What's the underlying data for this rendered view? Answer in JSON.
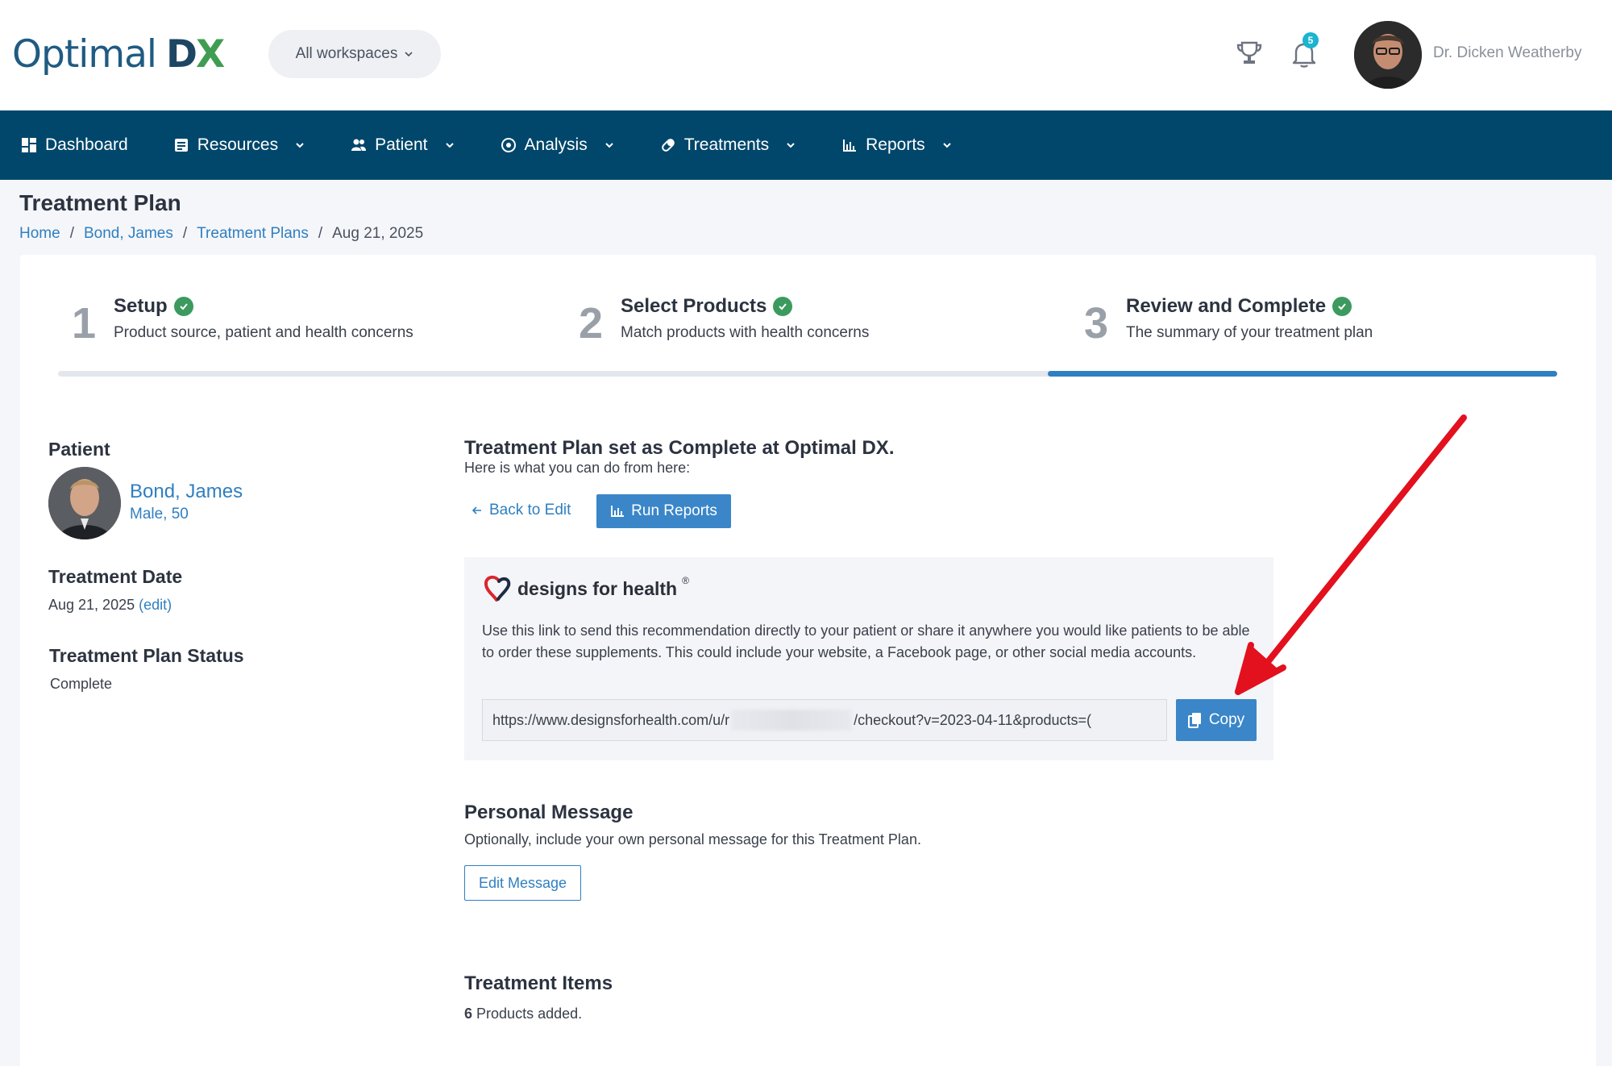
{
  "header": {
    "logo_part1": "Optimal",
    "logo_part2": "D",
    "logo_part3": "X",
    "workspace_select": "All workspaces",
    "notification_count": "5",
    "user_name": "Dr. Dicken Weatherby"
  },
  "nav": {
    "items": [
      {
        "label": "Dashboard",
        "icon": "dashboard-icon"
      },
      {
        "label": "Resources",
        "icon": "document-icon"
      },
      {
        "label": "Patient",
        "icon": "users-icon"
      },
      {
        "label": "Analysis",
        "icon": "target-icon"
      },
      {
        "label": "Treatments",
        "icon": "pill-icon"
      },
      {
        "label": "Reports",
        "icon": "bar-chart-icon"
      }
    ]
  },
  "page": {
    "title": "Treatment Plan",
    "breadcrumb": [
      "Home",
      "Bond, James",
      "Treatment Plans",
      "Aug 21, 2025"
    ]
  },
  "steps": [
    {
      "number": "1",
      "title": "Setup",
      "subtitle": "Product source, patient and health concerns"
    },
    {
      "number": "2",
      "title": "Select Products",
      "subtitle": "Match products with health concerns"
    },
    {
      "number": "3",
      "title": "Review and Complete",
      "subtitle": "The summary of your treatment plan"
    }
  ],
  "progress": {
    "active_step": 3,
    "total_steps": 3
  },
  "patient": {
    "label": "Patient",
    "name": "Bond, James",
    "meta": "Male, 50",
    "treatment_date_label": "Treatment Date",
    "treatment_date": "Aug 21, 2025",
    "edit_label": "(edit)",
    "status_label": "Treatment Plan Status",
    "status": "Complete"
  },
  "complete": {
    "title": "Treatment Plan set as Complete at Optimal DX.",
    "subtitle": "Here is what you can do from here:",
    "back_label": "Back to Edit",
    "run_reports_label": "Run Reports"
  },
  "dfh": {
    "brand": "designs for health",
    "brand_mark": "®",
    "description": "Use this link to send this recommendation directly to your patient or share it anywhere you would like patients to be able to order these supplements. This could include your website, a Facebook page, or other social media accounts.",
    "url_start": "https://www.designsforhealth.com/u/r",
    "url_end": "/checkout?v=2023-04-11&products=(",
    "copy_label": "Copy"
  },
  "personal_message": {
    "title": "Personal Message",
    "subtitle": "Optionally, include your own personal message for this Treatment Plan.",
    "edit_label": "Edit Message"
  },
  "treatment_items": {
    "title": "Treatment Items",
    "count": "6",
    "suffix": "Products added."
  },
  "colors": {
    "nav_bg": "#00476b",
    "accent": "#2f7fc1",
    "button": "#3a86c8",
    "check": "#3c9a5f",
    "annotation_arrow": "#e3101e"
  }
}
